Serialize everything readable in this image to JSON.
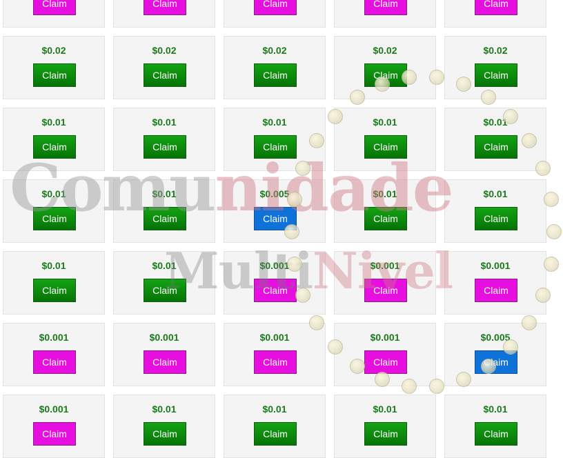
{
  "claim_label": "Claim",
  "colors": {
    "green": "#0a8a0a",
    "blue": "#0e72d8",
    "magenta": "#e60fe0",
    "amount_text": "#1a7a1a"
  },
  "watermark": {
    "part1": "Comu",
    "part1_accent": "nidade",
    "part2": "Multi",
    "part2_accent": "Nivel"
  },
  "rows": [
    [
      {
        "amount": "",
        "button": "magenta"
      },
      {
        "amount": "",
        "button": "magenta"
      },
      {
        "amount": "",
        "button": "magenta"
      },
      {
        "amount": "",
        "button": "magenta"
      },
      {
        "amount": "",
        "button": "magenta"
      }
    ],
    [
      {
        "amount": "$0.02",
        "button": "green"
      },
      {
        "amount": "$0.02",
        "button": "green"
      },
      {
        "amount": "$0.02",
        "button": "green"
      },
      {
        "amount": "$0.02",
        "button": "green"
      },
      {
        "amount": "$0.02",
        "button": "green"
      }
    ],
    [
      {
        "amount": "$0.01",
        "button": "green"
      },
      {
        "amount": "$0.01",
        "button": "green"
      },
      {
        "amount": "$0.01",
        "button": "green"
      },
      {
        "amount": "$0.01",
        "button": "green"
      },
      {
        "amount": "$0.01",
        "button": "green"
      }
    ],
    [
      {
        "amount": "$0.01",
        "button": "green"
      },
      {
        "amount": "$0.01",
        "button": "green"
      },
      {
        "amount": "$0.005",
        "button": "blue"
      },
      {
        "amount": "$0.01",
        "button": "green"
      },
      {
        "amount": "$0.01",
        "button": "green"
      }
    ],
    [
      {
        "amount": "$0.01",
        "button": "green"
      },
      {
        "amount": "$0.01",
        "button": "green"
      },
      {
        "amount": "$0.001",
        "button": "magenta"
      },
      {
        "amount": "$0.001",
        "button": "magenta"
      },
      {
        "amount": "$0.001",
        "button": "magenta"
      }
    ],
    [
      {
        "amount": "$0.001",
        "button": "magenta"
      },
      {
        "amount": "$0.001",
        "button": "magenta"
      },
      {
        "amount": "$0.001",
        "button": "magenta"
      },
      {
        "amount": "$0.001",
        "button": "magenta"
      },
      {
        "amount": "$0.005",
        "button": "blue"
      }
    ],
    [
      {
        "amount": "$0.001",
        "button": "magenta"
      },
      {
        "amount": "$0.01",
        "button": "green"
      },
      {
        "amount": "$0.01",
        "button": "green"
      },
      {
        "amount": "$0.01",
        "button": "green"
      },
      {
        "amount": "$0.01",
        "button": "green"
      }
    ]
  ]
}
